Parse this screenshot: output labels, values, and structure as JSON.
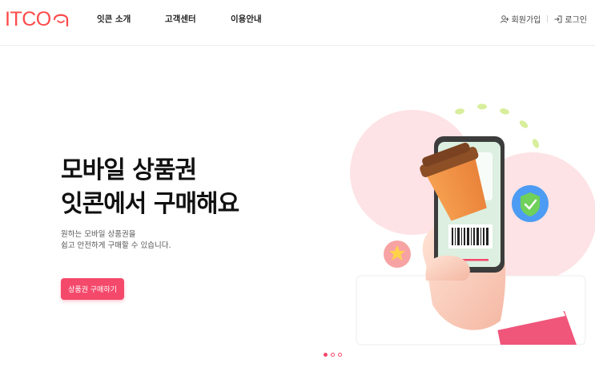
{
  "brand": {
    "logo_text": "ITCO",
    "accent": "#ff4b4b"
  },
  "nav": {
    "items": [
      {
        "label": "잇콘 소개"
      },
      {
        "label": "고객센터"
      },
      {
        "label": "이용안내"
      }
    ]
  },
  "util": {
    "signup_label": "회원가입",
    "signup_icon": "user-plus-icon",
    "login_label": "로그인",
    "login_icon": "login-icon"
  },
  "hero": {
    "title_line1": "모바일 상품권",
    "title_line2": "잇콘에서 구매해요",
    "sub_line1": "원하는 모바일 상품권을",
    "sub_line2": "쉽고 안전하게 구매할 수 있습니다.",
    "cta_label": "상품권 구매하기",
    "cta_color": "#f4496b"
  },
  "carousel": {
    "slide_count": 3,
    "active_index": 1
  }
}
